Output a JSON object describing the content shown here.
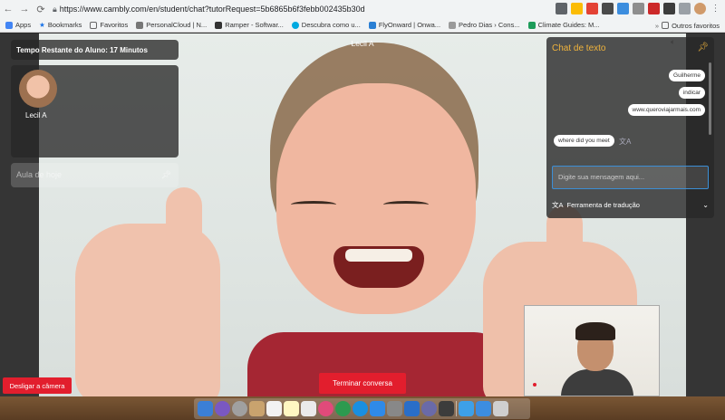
{
  "browser": {
    "url": "https://www.cambly.com/en/student/chat?tutorRequest=5b6865b6f3febb002435b30d",
    "bookmarks": [
      "Apps",
      "Bookmarks",
      "Favoritos",
      "PersonalCloud | N...",
      "Ramper - Softwar...",
      "Descubra como u...",
      "FlyOnward | Onwa...",
      "Pedro Dias › Cons...",
      "Climate Guides: M..."
    ],
    "other_bookmarks": "Outros favoritos"
  },
  "session": {
    "timer": "Tempo Restante do Aluno: 17 Minutos",
    "tutor_name": "Lecil A",
    "top_name": "Lecil A",
    "lesson_placeholder": "Aula de hoje"
  },
  "chat": {
    "title": "Chat de texto",
    "messages": [
      {
        "text": "Guilherme"
      },
      {
        "text": "indicar"
      },
      {
        "text": "www.queroviajarmais.com"
      },
      {
        "text": "where did you meet"
      }
    ],
    "input_placeholder": "Digite sua mensagem aqui...",
    "translation_tool": "Ferramenta de tradução"
  },
  "buttons": {
    "camera_off": "Desligar a câmera",
    "end_call": "Terminar conversa"
  },
  "colors": {
    "accent_red": "#e21e2d",
    "chat_title": "#f0b33c",
    "input_border": "#3b8fd6"
  }
}
